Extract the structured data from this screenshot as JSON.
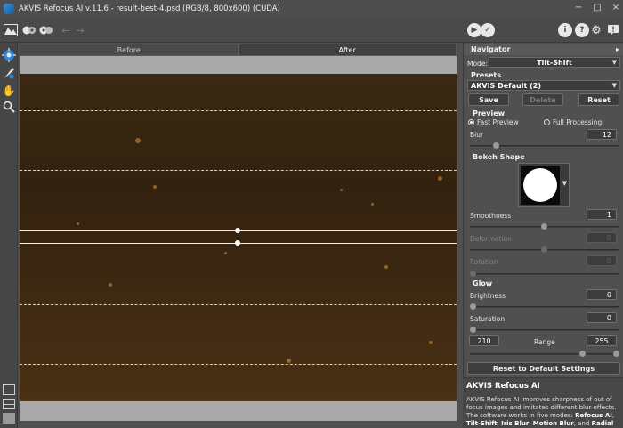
{
  "window": {
    "title": "AKVIS Refocus AI v.11.6 - result-best-4.psd (RGB/8, 800x600) (CUDA)",
    "buttons": [
      "−",
      "□",
      "×"
    ]
  },
  "toolbar": {
    "icons": [
      "open-icon",
      "batch-icon",
      "plugin-icon",
      "undo-icon",
      "redo-icon",
      "run-icon",
      "apply-icon",
      "info-icon",
      "help-icon",
      "settings-icon",
      "feedback-icon"
    ]
  },
  "view_tabs": {
    "before": "Before",
    "after": "After"
  },
  "panel": {
    "navigator": "Navigator",
    "mode_label": "Mode:",
    "mode_value": "Tilt-Shift",
    "presets_header": "Presets",
    "preset_value": "AKVIS Default (2)",
    "save": "Save",
    "delete": "Delete",
    "reset": "Reset",
    "preview_header": "Preview",
    "fast_preview": "Fast Preview",
    "full_processing": "Full Processing",
    "blur_label": "Blur",
    "blur_value": "12",
    "blur_level": 0.16,
    "bokeh_header": "Bokeh Shape",
    "smoothness_label": "Smoothness",
    "smoothness_value": "1",
    "deformation_label": "Deformation",
    "deformation_value": "0",
    "rotation_label": "Rotation",
    "rotation_value": "0",
    "glow_header": "Glow",
    "brightness_label": "Brightness",
    "brightness_value": "0",
    "saturation_label": "Saturation",
    "saturation_value": "0",
    "range_label": "Range",
    "range_min": "210",
    "range_max": "255",
    "reset_defaults": "Reset to Default Settings"
  },
  "help": {
    "title": "AKVIS Refocus AI",
    "text_1": "AKVIS Refocus AI improves sharpness of out of focus images and imitates different blur effects. The software works in five modes: ",
    "mode_1": "Refocus AI",
    "sep_1": ", ",
    "mode_2": "Tilt-Shift",
    "sep_2": ", ",
    "mode_3": "Iris Blur",
    "sep_3": ", ",
    "mode_4": "Motion Blur",
    "sep_4": ", and ",
    "mode_5": "Radial"
  },
  "colors": {
    "accent": "#3a8fd6",
    "image_dark": "#33220f",
    "image_light": "#4a3115"
  }
}
